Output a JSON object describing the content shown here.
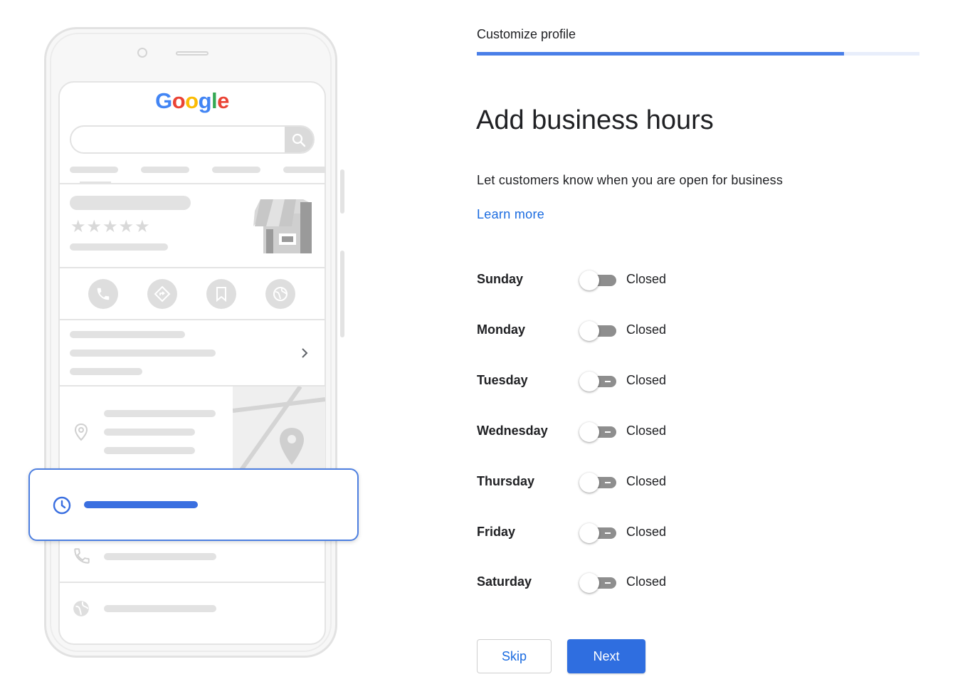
{
  "illustration": {
    "logo_letters": [
      {
        "ch": "G",
        "color": "#4285F4"
      },
      {
        "ch": "o",
        "color": "#EA4335"
      },
      {
        "ch": "o",
        "color": "#FBBC05"
      },
      {
        "ch": "g",
        "color": "#4285F4"
      },
      {
        "ch": "l",
        "color": "#34A853"
      },
      {
        "ch": "e",
        "color": "#EA4335"
      }
    ],
    "rating_stars": "★★★★★",
    "action_icons": [
      "phone-icon",
      "directions-icon",
      "bookmark-icon",
      "website-icon"
    ],
    "highlight_color": "#3a6fe0"
  },
  "header": {
    "step_label": "Customize profile",
    "progress": 0.83
  },
  "main": {
    "title": "Add business hours",
    "subtitle": "Let customers know when you are open for business",
    "learn_more": "Learn more",
    "days": [
      {
        "name": "Sunday",
        "status": "Closed",
        "open": false
      },
      {
        "name": "Monday",
        "status": "Closed",
        "open": false
      },
      {
        "name": "Tuesday",
        "status": "Closed",
        "open": false
      },
      {
        "name": "Wednesday",
        "status": "Closed",
        "open": false
      },
      {
        "name": "Thursday",
        "status": "Closed",
        "open": false
      },
      {
        "name": "Friday",
        "status": "Closed",
        "open": false
      },
      {
        "name": "Saturday",
        "status": "Closed",
        "open": false
      }
    ]
  },
  "footer": {
    "skip_label": "Skip",
    "next_label": "Next"
  },
  "colors": {
    "accent": "#1a6be0",
    "primary_button": "#2f6ee0",
    "progress": "#4a7fe8",
    "toggle_off": "#8e8e8e"
  }
}
